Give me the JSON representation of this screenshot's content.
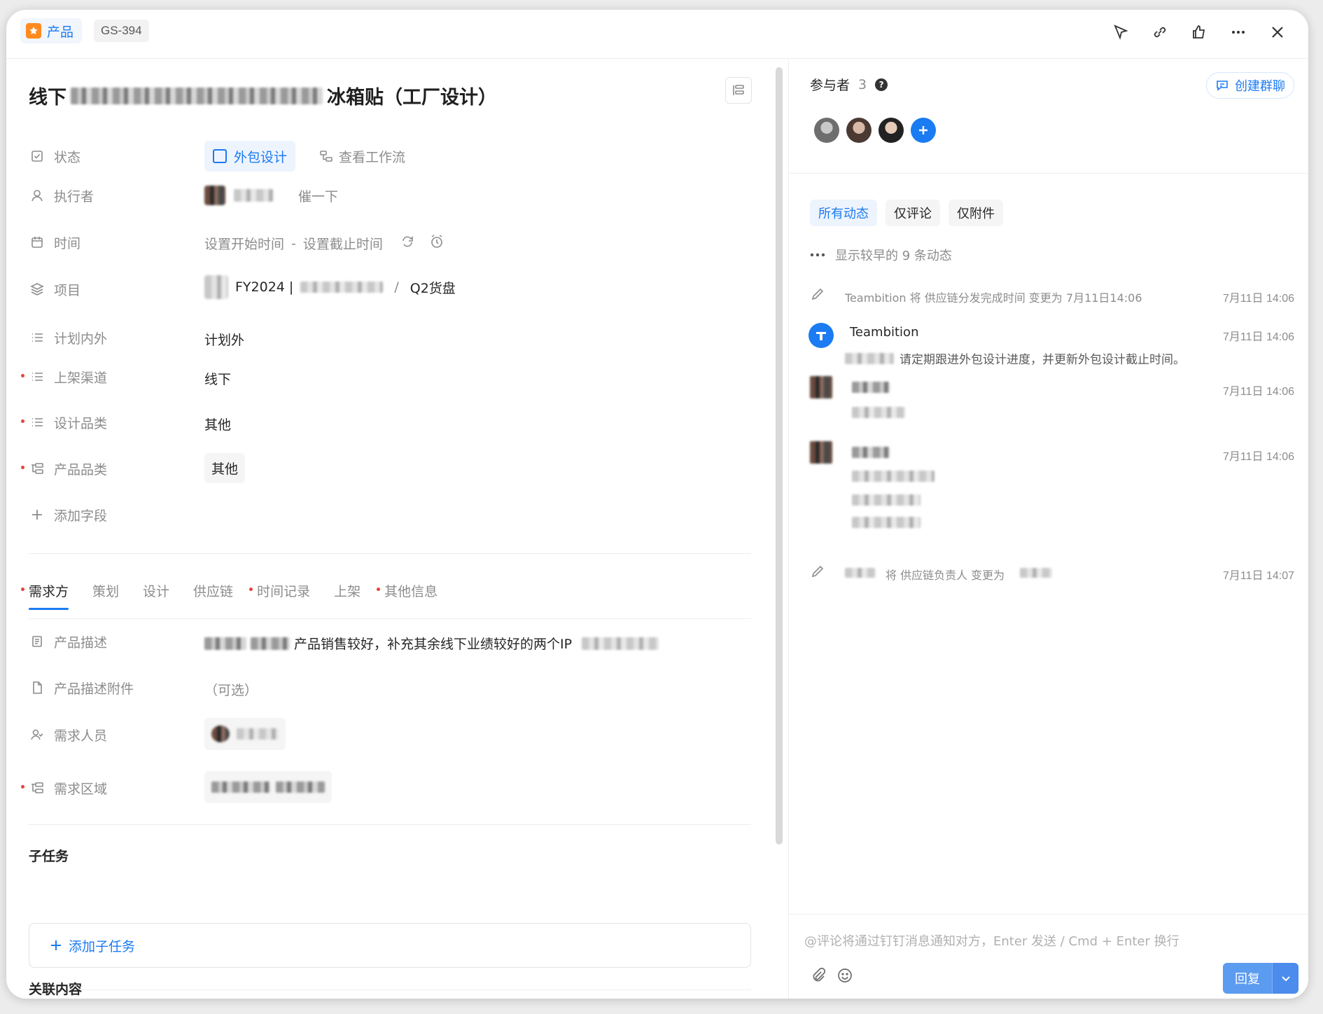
{
  "header": {
    "type_label": "产品",
    "task_id": "GS-394"
  },
  "task": {
    "title_prefix": "线下",
    "title_suffix": "冰箱贴（工厂设计）"
  },
  "fields": {
    "status": {
      "label": "状态",
      "value": "外包设计",
      "workflow_link": "查看工作流"
    },
    "assignee": {
      "label": "执行者",
      "nudge": "催一下"
    },
    "time": {
      "label": "时间",
      "start_placeholder": "设置开始时间",
      "separator": "-",
      "end_placeholder": "设置截止时间"
    },
    "project": {
      "label": "项目",
      "value_prefix": "FY2024 |",
      "slash": "/",
      "value_suffix": "Q2货盘"
    },
    "plan": {
      "label": "计划内外",
      "value": "计划外"
    },
    "channel": {
      "label": "上架渠道",
      "value": "线下"
    },
    "design_category": {
      "label": "设计品类",
      "value": "其他"
    },
    "product_category": {
      "label": "产品品类",
      "value": "其他"
    },
    "add_field": {
      "label": "添加字段"
    }
  },
  "tabs": [
    {
      "label": "需求方",
      "required": true,
      "active": true
    },
    {
      "label": "策划",
      "required": false
    },
    {
      "label": "设计",
      "required": false
    },
    {
      "label": "供应链",
      "required": false
    },
    {
      "label": "时间记录",
      "required": true
    },
    {
      "label": "上架",
      "required": false
    },
    {
      "label": "其他信息",
      "required": true
    }
  ],
  "requester": {
    "description": {
      "label": "产品描述",
      "value": "产品销售较好，补充其余线下业绩较好的两个IP"
    },
    "attachment": {
      "label": "产品描述附件",
      "placeholder": "（可选）"
    },
    "person": {
      "label": "需求人员"
    },
    "region": {
      "label": "需求区域"
    }
  },
  "subtasks": {
    "title": "子任务",
    "add_label": "添加子任务"
  },
  "related": {
    "title": "关联内容"
  },
  "participants": {
    "label": "参与者",
    "count": "3",
    "help": "?",
    "create_group": "创建群聊"
  },
  "activity": {
    "filters": [
      "所有动态",
      "仅评论",
      "仅附件"
    ],
    "earlier": "显示较早的 9 条动态",
    "items": [
      {
        "text": "Teambition 将 供应链分发完成时间 变更为 7月11日14:06",
        "time": "7月11日 14:06"
      },
      {
        "author": "Teambition",
        "time": "7月11日 14:06",
        "text": "请定期跟进外包设计进度，并更新外包设计截止时间。"
      },
      {
        "time": "7月11日 14:06"
      },
      {
        "time": "7月11日 14:06"
      },
      {
        "text_mid": "将 供应链负责人 变更为",
        "time": "7月11日 14:07"
      }
    ]
  },
  "comment": {
    "placeholder": "@评论将通过钉钉消息通知对方，Enter 发送 / Cmd + Enter 换行",
    "reply_label": "回复"
  },
  "colors": {
    "accent": "#1b7bf2",
    "required": "#e8443a",
    "type_icon": "#ff8a1f"
  }
}
